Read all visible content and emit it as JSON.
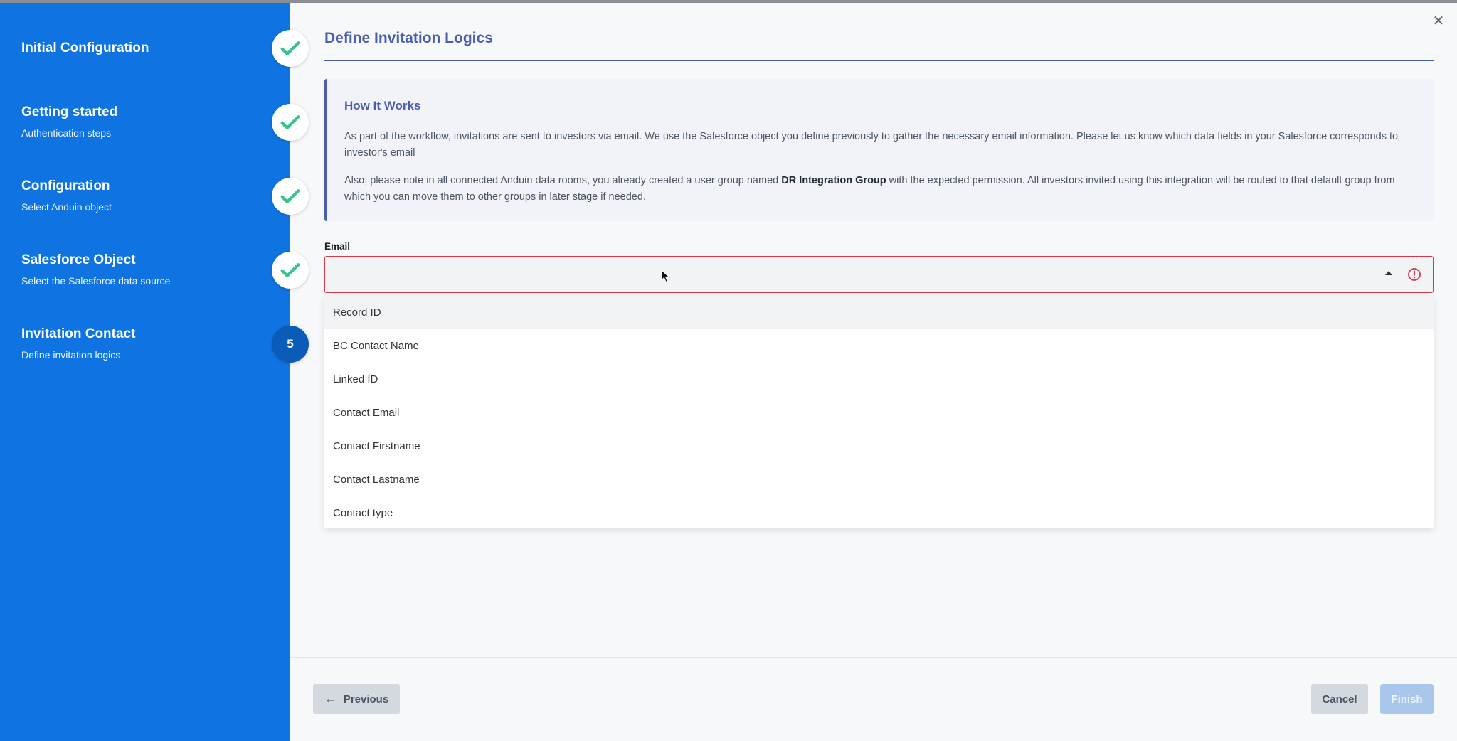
{
  "colors": {
    "sidebar_bg": "#0f74e2",
    "accent": "#4a5ea9",
    "check_green": "#3ec28c",
    "error_red": "#d13a4a",
    "current_step": "#0a5cb8"
  },
  "steps": [
    {
      "title": "Initial Configuration",
      "subtitle": "",
      "status": "done",
      "icon": "check-icon"
    },
    {
      "title": "Getting started",
      "subtitle": "Authentication steps",
      "status": "done",
      "icon": "check-icon"
    },
    {
      "title": "Configuration",
      "subtitle": "Select Anduin object",
      "status": "done",
      "icon": "check-icon"
    },
    {
      "title": "Salesforce Object",
      "subtitle": "Select the Salesforce data source",
      "status": "done",
      "icon": "check-icon"
    },
    {
      "title": "Invitation Contact",
      "subtitle": "Define invitation logics",
      "status": "current",
      "number": "5"
    }
  ],
  "main": {
    "title": "Define Invitation Logics",
    "close_icon": "close-icon"
  },
  "info": {
    "title": "How It Works",
    "p1": "As part of the workflow, invitations are sent to investors via email. We use the Salesforce object you define previously to gather the necessary email information. Please let us know which data fields in your Salesforce corresponds to investor's email",
    "p2_before": "Also, please note in all connected Anduin data rooms, you already created a user group named ",
    "p2_bold": "DR Integration Group",
    "p2_after": " with the expected permission. All investors invited using this integration will be routed to that default group from which you can move them to other groups in later stage if needed."
  },
  "email": {
    "label": "Email",
    "value": "",
    "options": [
      "Record ID",
      "BC Contact Name",
      "Linked ID",
      "Contact Email",
      "Contact Firstname",
      "Contact Lastname",
      "Contact type"
    ],
    "highlighted_index": 0
  },
  "footer": {
    "previous_label": "Previous",
    "cancel_label": "Cancel",
    "finish_label": "Finish"
  }
}
